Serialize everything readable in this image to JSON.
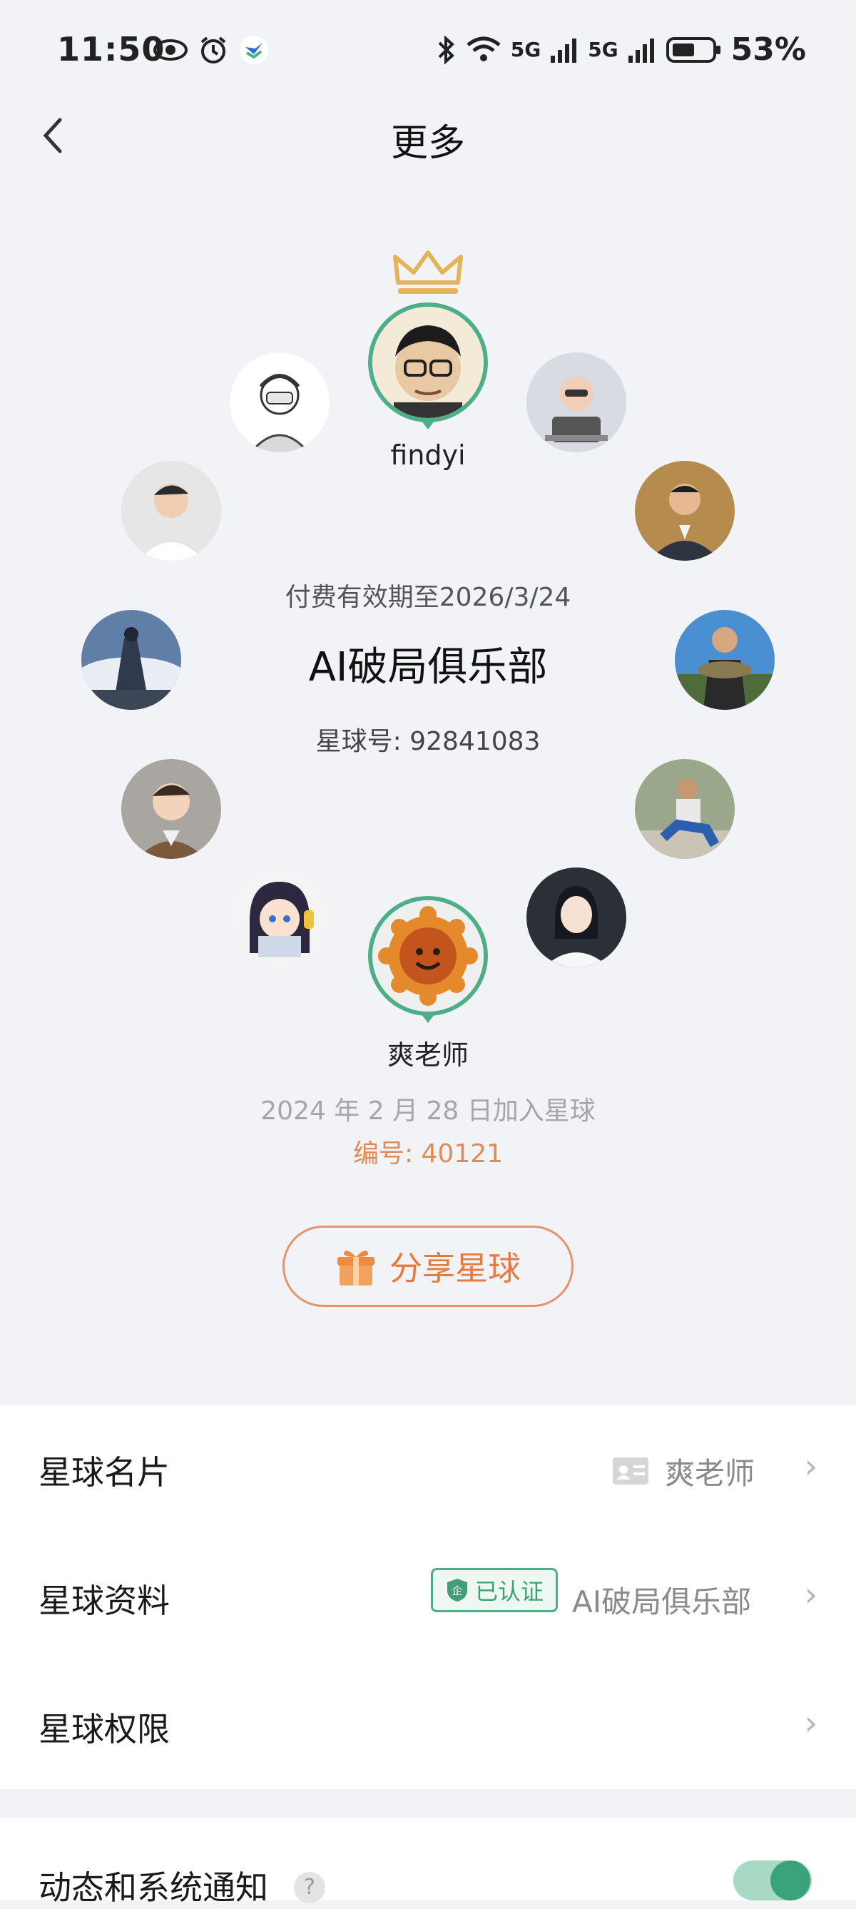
{
  "status_bar": {
    "time": "11:50",
    "battery": "53%",
    "signal_label": "5G",
    "icons": [
      "eye-icon",
      "alarm-icon",
      "app-notification-icon",
      "bluetooth-icon",
      "wifi-icon",
      "signal-icon",
      "signal-icon",
      "battery-icon"
    ]
  },
  "header": {
    "title": "更多",
    "back_icon": "chevron-left-icon"
  },
  "planet": {
    "owner_name": "findyi",
    "expiry": "付费有效期至2026/3/24",
    "name": "AI破局俱乐部",
    "planet_id": "星球号: 92841083",
    "me_name": "爽老师",
    "joined": "2024 年 2 月 28 日加入星球",
    "member_no": "编号: 40121"
  },
  "share": {
    "label": "分享星球",
    "icon": "gift-icon"
  },
  "settings": {
    "card": {
      "label": "星球名片",
      "value": "爽老师"
    },
    "profile": {
      "label": "星球资料",
      "badge": "已认证",
      "value": "AI破局俱乐部"
    },
    "permissions": {
      "label": "星球权限"
    },
    "notifications": {
      "label": "动态和系统通知",
      "help": "?",
      "enabled": true
    }
  },
  "colors": {
    "accent_green": "#4fae8a",
    "accent_orange": "#e8793f",
    "background": "#f2f3f7"
  }
}
